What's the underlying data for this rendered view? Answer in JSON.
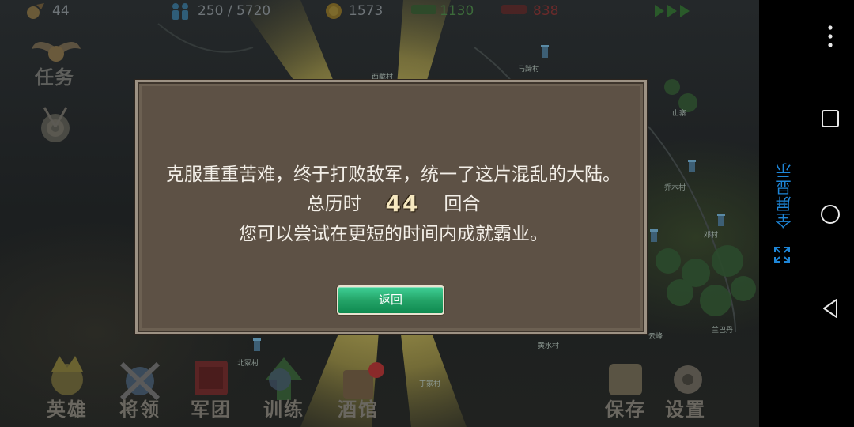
{
  "top_stats": {
    "level": "44",
    "population": "250 / 5720",
    "gold": "1573",
    "green_value": "1130",
    "red_value": "838"
  },
  "side_menu": {
    "quests_label": "任务"
  },
  "map_labels": [
    "西藏村",
    "马蹄村",
    "乔木村",
    "邓村",
    "兰巴丹",
    "云峰",
    "山寨",
    "北冢村",
    "黄水村",
    "丁家村"
  ],
  "bottom_menu": [
    {
      "label": "英雄"
    },
    {
      "label": "将领"
    },
    {
      "label": "军团"
    },
    {
      "label": "训练"
    },
    {
      "label": "酒馆"
    },
    {
      "label": "保存"
    },
    {
      "label": "设置"
    }
  ],
  "dialog": {
    "line1": "克服重重苦难，终于打败敌军，统一了这片混乱的大陆。",
    "line2_prefix": "总历时",
    "turns": "44",
    "line2_suffix": "回合",
    "line3": "您可以尝试在更短的时间内成就霸业。",
    "back_button": "返回"
  },
  "nav_bar": {
    "fullscreen_label": "全屏显示"
  },
  "colors": {
    "dialog_bg": "#5d5145",
    "button_green": "#24a468",
    "nav_accent": "#1e86d8"
  }
}
